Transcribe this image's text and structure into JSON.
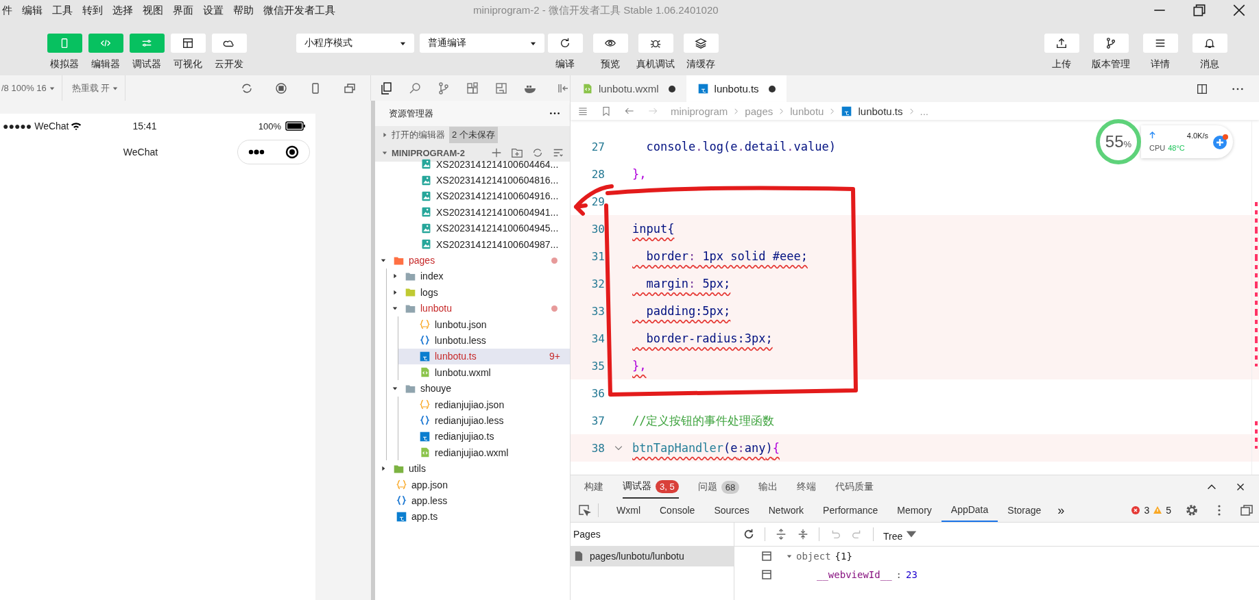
{
  "menu": [
    "件",
    "编辑",
    "工具",
    "转到",
    "选择",
    "视图",
    "界面",
    "设置",
    "帮助",
    "微信开发者工具"
  ],
  "window": {
    "title": "miniprogram-2 - 微信开发者工具 Stable 1.06.2401020"
  },
  "toolbar": {
    "modes": [
      {
        "label": "模拟器",
        "kind": "phone",
        "on": true
      },
      {
        "label": "编辑器",
        "kind": "code",
        "on": true
      },
      {
        "label": "调试器",
        "kind": "sliders",
        "on": true
      },
      {
        "label": "可视化",
        "kind": "layout",
        "on": false
      },
      {
        "label": "云开发",
        "kind": "cloud",
        "on": false
      }
    ],
    "dropdowns": [
      "小程序模式",
      "普通编译"
    ],
    "actions": [
      {
        "label": "编译",
        "kind": "refresh"
      },
      {
        "label": "预览",
        "kind": "eye"
      },
      {
        "label": "真机调试",
        "kind": "bug"
      },
      {
        "label": "清缓存",
        "kind": "layers"
      }
    ],
    "right": [
      {
        "label": "上传",
        "kind": "upload"
      },
      {
        "label": "版本管理",
        "kind": "branch"
      },
      {
        "label": "详情",
        "kind": "menu"
      },
      {
        "label": "消息",
        "kind": "bell"
      }
    ]
  },
  "simulator": {
    "device": "/8 100% 16",
    "hot_reload": "热重载 开",
    "carrier": "●●●●● WeChat",
    "time": "15:41",
    "battery": "100%",
    "nav_title": "WeChat"
  },
  "explorer": {
    "title": "资源管理器",
    "open_editors": "打开的编辑器",
    "unsaved": "2 个未保存",
    "root": "MINIPROGRAM-2",
    "tree": [
      {
        "kind": "scrolled-folder",
        "children": [
          {
            "kind": "image",
            "label": "XS2023141214100604464...",
            "selected": false,
            "modified": false
          },
          {
            "kind": "image",
            "label": "XS2023141214100604816...",
            "selected": false,
            "modified": false
          },
          {
            "kind": "image",
            "label": "XS2023141214100604916...",
            "selected": false,
            "modified": false
          },
          {
            "kind": "image",
            "label": "XS2023141214100604941...",
            "selected": false,
            "modified": false
          },
          {
            "kind": "image",
            "label": "XS2023141214100604945...",
            "selected": false,
            "modified": false
          },
          {
            "kind": "image",
            "label": "XS2023141214100604987...",
            "selected": false,
            "modified": false
          }
        ]
      },
      {
        "kind": "pages-folder",
        "label": "pages",
        "expanded": true,
        "selected": false,
        "modified": true,
        "children": [
          {
            "kind": "folder",
            "label": "index",
            "expanded": false,
            "selected": false,
            "modified": false
          },
          {
            "kind": "logs-folder",
            "label": "logs",
            "expanded": false,
            "selected": false,
            "modified": false
          },
          {
            "kind": "folder",
            "label": "lunbotu",
            "expanded": true,
            "selected": false,
            "modified": true,
            "children": [
              {
                "kind": "json",
                "label": "lunbotu.json",
                "selected": false,
                "modified": false
              },
              {
                "kind": "less",
                "label": "lunbotu.less",
                "selected": false,
                "modified": false
              },
              {
                "kind": "ts",
                "label": "lunbotu.ts",
                "selected": true,
                "modified": true,
                "badge": "9+"
              },
              {
                "kind": "wxml",
                "label": "lunbotu.wxml",
                "selected": false,
                "modified": false
              }
            ]
          },
          {
            "kind": "folder",
            "label": "shouye",
            "expanded": true,
            "selected": false,
            "modified": false,
            "children": [
              {
                "kind": "json",
                "label": "redianjujiao.json",
                "selected": false,
                "modified": false
              },
              {
                "kind": "less",
                "label": "redianjujiao.less",
                "selected": false,
                "modified": false
              },
              {
                "kind": "ts",
                "label": "redianjujiao.ts",
                "selected": false,
                "modified": false
              },
              {
                "kind": "wxml",
                "label": "redianjujiao.wxml",
                "selected": false,
                "modified": false
              }
            ]
          }
        ]
      },
      {
        "kind": "utils-folder",
        "label": "utils",
        "expanded": false,
        "selected": false,
        "modified": false
      },
      {
        "kind": "json",
        "label": "app.json",
        "selected": false,
        "modified": false
      },
      {
        "kind": "less",
        "label": "app.less",
        "selected": false,
        "modified": false
      },
      {
        "kind": "ts",
        "label": "app.ts",
        "selected": false,
        "modified": false
      }
    ]
  },
  "editor": {
    "tabs": [
      {
        "label": "lunbotu.wxml",
        "kind": "wxml",
        "selected": false,
        "unsaved": true
      },
      {
        "label": "lunbotu.ts",
        "kind": "ts",
        "selected": true,
        "unsaved": true
      }
    ],
    "breadcrumb": [
      {
        "label": "miniprogram",
        "kind": "folder"
      },
      {
        "label": "pages",
        "kind": "folder"
      },
      {
        "label": "lunbotu",
        "kind": "folder"
      },
      {
        "label": "lunbotu.ts",
        "kind": "ts"
      },
      {
        "label": "...",
        "kind": "symbol"
      }
    ],
    "lines": [
      {
        "number": "27",
        "error": false,
        "fold": false,
        "tokens": [
          {
            "t": "  console",
            "kind": "plain"
          },
          {
            "t": ".",
            "kind": "punct"
          },
          {
            "t": "log",
            "kind": "plain"
          },
          {
            "t": "(",
            "kind": "plain"
          },
          {
            "t": "e",
            "kind": "plain"
          },
          {
            "t": ".",
            "kind": "punct"
          },
          {
            "t": "detail",
            "kind": "plain"
          },
          {
            "t": ".",
            "kind": "punct"
          },
          {
            "t": "value",
            "kind": "plain"
          },
          {
            "t": ")",
            "kind": "plain"
          }
        ]
      },
      {
        "number": "28",
        "error": false,
        "fold": false,
        "tokens": [
          {
            "t": "},",
            "kind": "brace"
          }
        ]
      },
      {
        "number": "29",
        "error": false,
        "fold": false
      },
      {
        "number": "30",
        "error": true,
        "fold": false,
        "tokens": [
          {
            "t": "input{",
            "kind": "plain"
          }
        ]
      },
      {
        "number": "31",
        "error": true,
        "fold": false,
        "tokens": [
          {
            "t": "  border",
            "kind": "plain"
          },
          {
            "t": ":",
            "kind": "punct"
          },
          {
            "t": " 1px solid #eee;",
            "kind": "plain"
          }
        ]
      },
      {
        "number": "32",
        "error": true,
        "fold": false,
        "tokens": [
          {
            "t": "  margin",
            "kind": "plain"
          },
          {
            "t": ":",
            "kind": "punct"
          },
          {
            "t": " 5px;",
            "kind": "plain"
          }
        ]
      },
      {
        "number": "33",
        "error": true,
        "fold": false,
        "tokens": [
          {
            "t": "  padding:5px;",
            "kind": "plain"
          }
        ]
      },
      {
        "number": "34",
        "error": true,
        "fold": false,
        "tokens": [
          {
            "t": "  border-radius:3px;",
            "kind": "plain"
          }
        ]
      },
      {
        "number": "35",
        "error": true,
        "fold": false,
        "tokens": [
          {
            "t": "},",
            "kind": "brace"
          }
        ]
      },
      {
        "number": "36",
        "error": false,
        "fold": false
      },
      {
        "number": "37",
        "error": false,
        "fold": false,
        "tokens": [
          {
            "t": "//定义按钮的事件处理函数",
            "kind": "comment"
          }
        ]
      },
      {
        "number": "38",
        "error": true,
        "fold": true,
        "tokens": [
          {
            "t": "btnTapHandler",
            "kind": "func"
          },
          {
            "t": "(",
            "kind": "plain"
          },
          {
            "t": "e",
            "kind": "plain"
          },
          {
            "t": ":",
            "kind": "punct"
          },
          {
            "t": "any",
            "kind": "plain"
          },
          {
            "t": ")",
            "kind": "plain"
          },
          {
            "t": "{",
            "kind": "brace"
          }
        ]
      }
    ]
  },
  "monitor": {
    "value": "55",
    "unit": "%",
    "speed": "4.0K/s",
    "cpu_label": "CPU",
    "cpu_temp": "48°C"
  },
  "panel": {
    "tabs": [
      {
        "label": "构建",
        "kind": "plain",
        "selected": false
      },
      {
        "label": "调试器",
        "kind": "error",
        "selected": true,
        "badge": "3, 5"
      },
      {
        "label": "问题",
        "kind": "count",
        "selected": false,
        "badge": "68"
      },
      {
        "label": "输出",
        "kind": "plain",
        "selected": false
      },
      {
        "label": "终端",
        "kind": "plain",
        "selected": false
      },
      {
        "label": "代码质量",
        "kind": "plain",
        "selected": false
      }
    ],
    "devtools_tabs": [
      {
        "label": "Wxml",
        "selected": false
      },
      {
        "label": "Console",
        "selected": false
      },
      {
        "label": "Sources",
        "selected": false
      },
      {
        "label": "Network",
        "selected": false
      },
      {
        "label": "Performance",
        "selected": false
      },
      {
        "label": "Memory",
        "selected": false
      },
      {
        "label": "AppData",
        "selected": true
      },
      {
        "label": "Storage",
        "selected": false
      }
    ],
    "more": "»",
    "errors": "3",
    "warnings": "5",
    "pages_heading": "Pages",
    "pages": [
      {
        "label": "pages/lunbotu/lunbotu",
        "selected": true
      }
    ],
    "view_mode": "Tree",
    "data": [
      {
        "key": "object",
        "value": "{1}",
        "kind": "object"
      },
      {
        "key": "__webviewId__",
        "separator": ":",
        "value": "23",
        "kind": "field"
      }
    ]
  }
}
